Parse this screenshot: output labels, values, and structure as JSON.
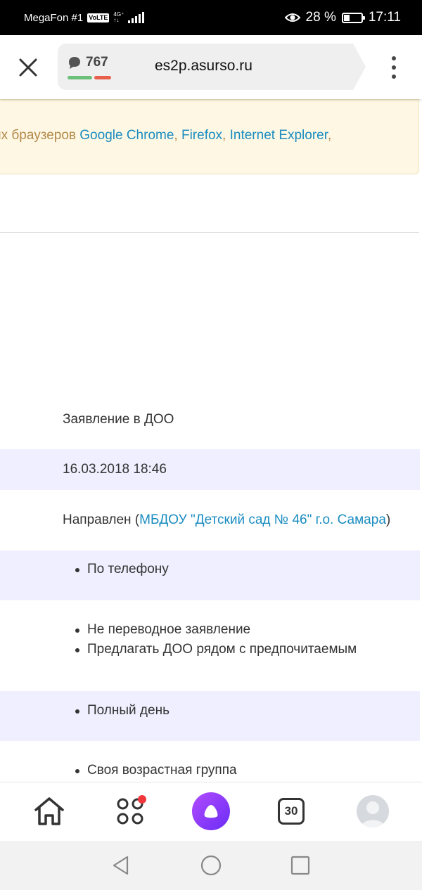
{
  "status_bar": {
    "carrier": "MegaFon #1",
    "volte": "VoLTE",
    "network": "4G⁺",
    "battery_percent": "28 %",
    "time": "17:11"
  },
  "toolbar": {
    "comment_count": "767",
    "url": "es2p.asurso.ru"
  },
  "notice": {
    "prefix": "их браузеров ",
    "browsers": [
      "Google Chrome",
      "Firefox",
      "Internet Explorer"
    ],
    "sep1": ", ",
    "sep2": ", ",
    "suffix": ","
  },
  "rows": {
    "type": "Заявление в ДОО",
    "date": "16.03.2018 18:46",
    "status_prefix": "Направлен (",
    "status_link": "МБДОУ \"Детский сад № 46\" г.о. Самара",
    "status_suffix": ")",
    "contact": [
      "По телефону"
    ],
    "options": [
      "Не переводное заявление",
      "Предлагать ДОО рядом с предпочитаемым"
    ],
    "schedule": [
      "Полный день"
    ],
    "group": [
      "Своя возрастная группа"
    ]
  },
  "bottom_nav": {
    "tabs_count": "30",
    "notification_dot_color": "#f1373c",
    "alice_color": "#8a3cf7"
  },
  "colors": {
    "link": "#1a8cc0",
    "notice_bg": "#fdf7e3",
    "alt_row_bg": "#efefff"
  }
}
